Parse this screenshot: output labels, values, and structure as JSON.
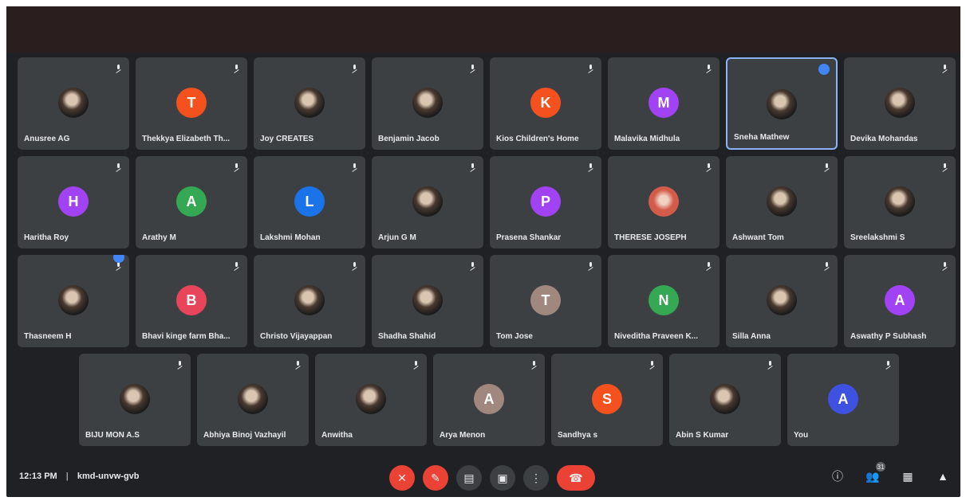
{
  "meeting": {
    "time": "12:13 PM",
    "code": "kmd-unvw-gvb"
  },
  "participants": {
    "row0": [
      {
        "name": "Anusree AG",
        "initial": "",
        "photo": true,
        "color": "#1b1b1b"
      },
      {
        "name": "Thekkya Elizabeth Th...",
        "initial": "T",
        "photo": false,
        "color": "#f4511e"
      },
      {
        "name": "Joy CREATES",
        "initial": "",
        "photo": true,
        "color": "#1b1b1b"
      },
      {
        "name": "Benjamin Jacob",
        "initial": "",
        "photo": true,
        "color": "#1b1b1b"
      },
      {
        "name": "Kios Children's Home",
        "initial": "K",
        "photo": false,
        "color": "#f4511e"
      },
      {
        "name": "Malavika Midhula",
        "initial": "M",
        "photo": false,
        "color": "#a142f4"
      },
      {
        "name": "Sneha Mathew",
        "initial": "",
        "photo": true,
        "color": "#1b1b1b",
        "active": true,
        "badge": true
      },
      {
        "name": "Devika Mohandas",
        "initial": "",
        "photo": true,
        "color": "#1b1b1b"
      }
    ],
    "row1": [
      {
        "name": "Haritha Roy",
        "initial": "H",
        "photo": false,
        "color": "#a142f4"
      },
      {
        "name": "Arathy M",
        "initial": "A",
        "photo": false,
        "color": "#34a853"
      },
      {
        "name": "Lakshmi Mohan",
        "initial": "L",
        "photo": false,
        "color": "#1a73e8"
      },
      {
        "name": "Arjun G M",
        "initial": "",
        "photo": true,
        "color": "#1b1b1b"
      },
      {
        "name": "Prasena Shankar",
        "initial": "P",
        "photo": false,
        "color": "#a142f4"
      },
      {
        "name": "THERESE JOSEPH",
        "initial": "",
        "photo": true,
        "color": "#d35b4a"
      },
      {
        "name": "Ashwant Tom",
        "initial": "",
        "photo": true,
        "color": "#1b1b1b"
      },
      {
        "name": "Sreelakshmi S",
        "initial": "",
        "photo": true,
        "color": "#1b1b1b"
      }
    ],
    "row2": [
      {
        "name": "Thasneem H",
        "initial": "",
        "photo": true,
        "color": "#1b1b1b",
        "cornerbadge": true
      },
      {
        "name": "Bhavi kinge farm Bha...",
        "initial": "B",
        "photo": false,
        "color": "#e8445a"
      },
      {
        "name": "Christo Vijayappan",
        "initial": "",
        "photo": true,
        "color": "#1b1b1b"
      },
      {
        "name": "Shadha Shahid",
        "initial": "",
        "photo": true,
        "color": "#1b1b1b"
      },
      {
        "name": "Tom Jose",
        "initial": "T",
        "photo": false,
        "color": "#a1887f"
      },
      {
        "name": "Niveditha Praveen K...",
        "initial": "N",
        "photo": false,
        "color": "#34a853"
      },
      {
        "name": "Silla Anna",
        "initial": "",
        "photo": true,
        "color": "#1b1b1b"
      },
      {
        "name": "Aswathy P Subhash",
        "initial": "A",
        "photo": false,
        "color": "#a142f4"
      }
    ],
    "row3": [
      {
        "name": "BIJU MON A.S",
        "initial": "",
        "photo": true,
        "color": "#1b1b1b"
      },
      {
        "name": "Abhiya Binoj Vazhayil",
        "initial": "",
        "photo": true,
        "color": "#1b1b1b"
      },
      {
        "name": "Anwitha",
        "initial": "",
        "photo": true,
        "color": "#1b1b1b"
      },
      {
        "name": "Arya Menon",
        "initial": "A",
        "photo": false,
        "color": "#a1887f"
      },
      {
        "name": "Sandhya s",
        "initial": "S",
        "photo": false,
        "color": "#f4511e"
      },
      {
        "name": "Abin S Kumar",
        "initial": "",
        "photo": true,
        "color": "#1b1b1b"
      },
      {
        "name": "You",
        "initial": "A",
        "photo": false,
        "color": "#3f51e0"
      }
    ]
  },
  "controls": {
    "mic_icon": "mic-off-icon",
    "camera_icon": "camera-off-icon",
    "captions_icon": "captions-icon",
    "present_icon": "present-icon",
    "more_icon": "more-options-icon",
    "hangup_icon": "hangup-icon"
  },
  "right_controls": {
    "info_icon": "info-icon",
    "people_icon": "people-icon",
    "people_count": "31",
    "chat_icon": "chat-icon",
    "activities_icon": "activities-icon"
  },
  "colors": {
    "background": "#202124",
    "tile": "#3c4043",
    "active_border": "#8ab4f8",
    "hangup": "#ea4335"
  }
}
